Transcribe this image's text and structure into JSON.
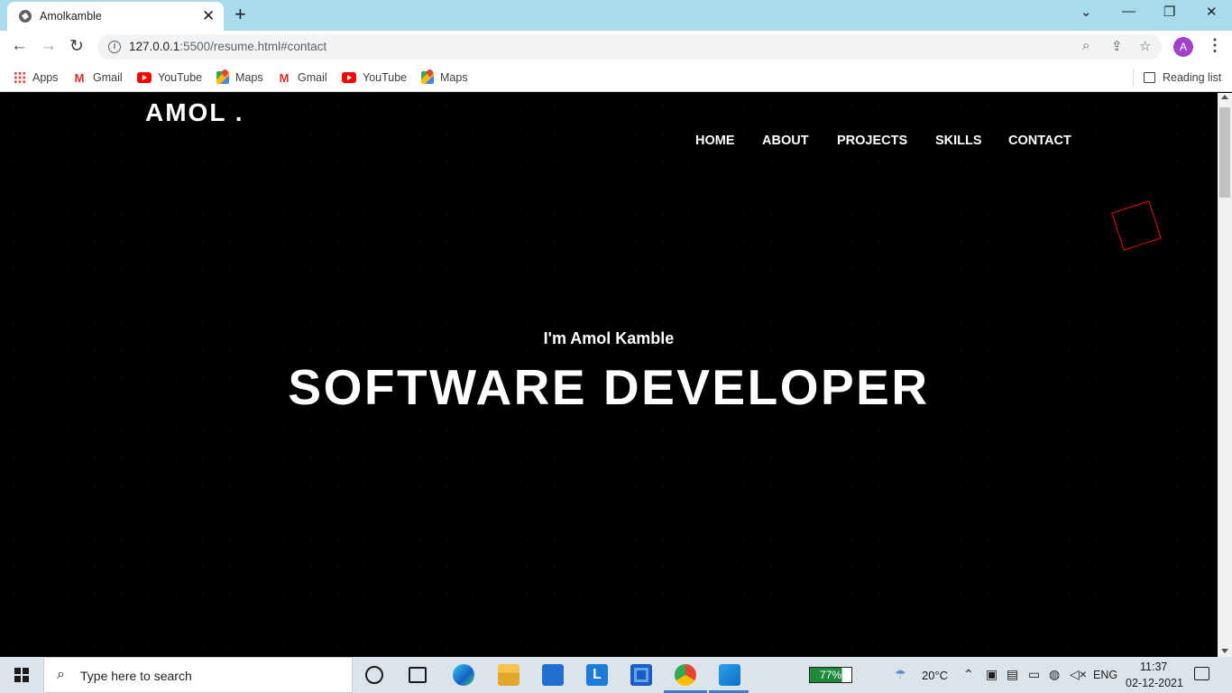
{
  "browser": {
    "tab_title": "Amolkamble",
    "url_host": "127.0.0.1",
    "url_path": ":5500/resume.html#contact",
    "avatar_letter": "A",
    "bookmarks": [
      "Apps",
      "Gmail",
      "YouTube",
      "Maps",
      "Gmail",
      "YouTube",
      "Maps"
    ],
    "reading_list": "Reading list"
  },
  "site": {
    "logo": "AMOL .",
    "nav": [
      "HOME",
      "ABOUT",
      "PROJECTS",
      "SKILLS",
      "CONTACT"
    ],
    "intro": "I'm Amol Kamble",
    "headline": "SOFTWARE DEVELOPER"
  },
  "taskbar": {
    "search_placeholder": "Type here to search",
    "battery": "77%",
    "temperature": "20°C",
    "language": "ENG",
    "time": "11:37",
    "date": "02-12-2021"
  },
  "colors": {
    "tabstrip": "#a8dcec",
    "page_bg": "#000000",
    "accent_square": "#e01010",
    "avatar": "#a142c9"
  }
}
